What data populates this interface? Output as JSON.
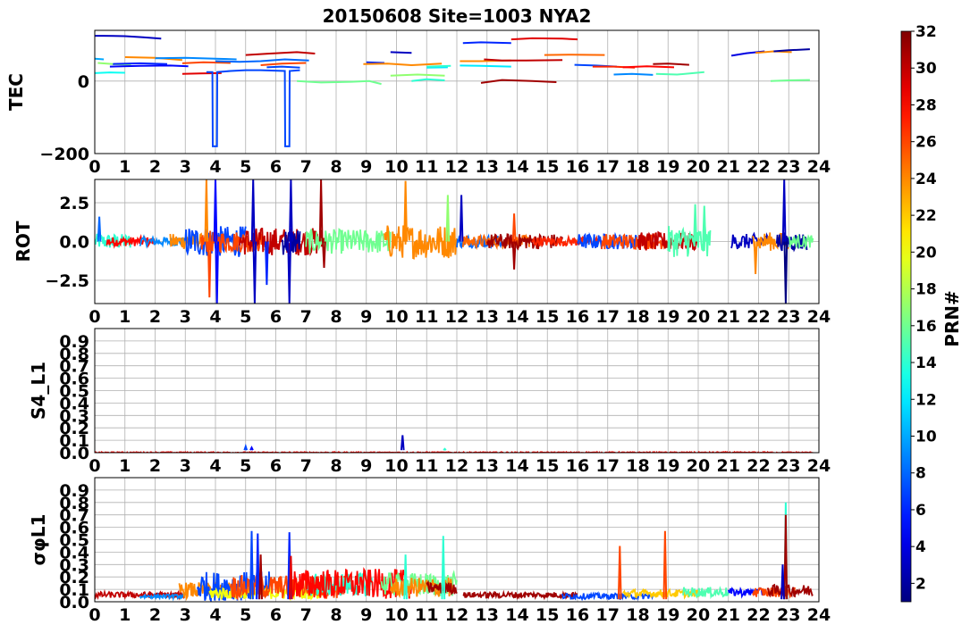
{
  "figure": {
    "title": "20150608 Site=1003 NYA2",
    "colorbar": {
      "label": "PRN#",
      "min": 1,
      "max": 32,
      "ticks": [
        2,
        4,
        6,
        8,
        10,
        12,
        14,
        16,
        18,
        20,
        22,
        24,
        26,
        28,
        30,
        32
      ],
      "colormap": "jet"
    }
  },
  "chart_data": [
    {
      "id": "tec",
      "type": "line",
      "ylabel": "TEC",
      "xlim": [
        0,
        24
      ],
      "ylim": [
        -200,
        140
      ],
      "xticks": [
        0,
        1,
        2,
        3,
        4,
        5,
        6,
        7,
        8,
        9,
        10,
        11,
        12,
        13,
        14,
        15,
        16,
        17,
        18,
        19,
        20,
        21,
        22,
        23,
        24
      ],
      "yticks": [
        0,
        -200
      ],
      "ytick_labels": [
        "0",
        "−200"
      ],
      "grid": true,
      "series": [
        {
          "prn": 3,
          "x": [
            0.0,
            0.3,
            1.0,
            1.6,
            2.2
          ],
          "y": [
            125,
            125,
            124,
            121,
            117
          ]
        },
        {
          "prn": 10,
          "x": [
            0.0,
            0.3
          ],
          "y": [
            62,
            60
          ]
        },
        {
          "prn": 13,
          "x": [
            0.0,
            0.5,
            1.0
          ],
          "y": [
            22,
            24,
            23
          ]
        },
        {
          "prn": 17,
          "x": [
            0.1,
            0.6,
            1.2
          ],
          "y": [
            50,
            47,
            45
          ]
        },
        {
          "prn": 5,
          "x": [
            0.5,
            1.5,
            2.5,
            3.1
          ],
          "y": [
            40,
            42,
            43,
            41
          ]
        },
        {
          "prn": 24,
          "x": [
            1.0,
            2.0,
            2.9
          ],
          "y": [
            66,
            64,
            58
          ]
        },
        {
          "prn": 6,
          "x": [
            0.6,
            1.5,
            2.4
          ],
          "y": [
            47,
            49,
            47
          ]
        },
        {
          "prn": 9,
          "x": [
            2.0,
            3.0,
            4.0,
            4.7
          ],
          "y": [
            63,
            64,
            62,
            60
          ]
        },
        {
          "prn": 26,
          "x": [
            2.9,
            3.6,
            4.5
          ],
          "y": [
            49,
            52,
            50
          ]
        },
        {
          "prn": 29,
          "x": [
            2.9,
            3.5,
            4.2
          ],
          "y": [
            20,
            21,
            22
          ]
        },
        {
          "prn": 7,
          "x": [
            3.7,
            3.9,
            3.91,
            4.05,
            4.06,
            4.5,
            5.0,
            5.5,
            6.3,
            6.31,
            6.45,
            6.46,
            6.8
          ],
          "y": [
            25,
            25,
            -180,
            -180,
            25,
            28,
            30,
            30,
            28,
            -180,
            -180,
            28,
            30
          ]
        },
        {
          "prn": 8,
          "x": [
            4.0,
            4.8,
            5.5,
            6.3,
            7.1
          ],
          "y": [
            55,
            53,
            55,
            60,
            57
          ]
        },
        {
          "prn": 30,
          "x": [
            5.0,
            5.8,
            6.7,
            7.3
          ],
          "y": [
            72,
            76,
            80,
            76
          ]
        },
        {
          "prn": 26,
          "x": [
            5.5,
            6.2,
            7.0
          ],
          "y": [
            44,
            48,
            50
          ]
        },
        {
          "prn": 7,
          "x": [
            5.7,
            6.2,
            6.8
          ],
          "y": [
            38,
            40,
            37
          ]
        },
        {
          "prn": 16,
          "x": [
            6.7,
            7.5,
            8.5,
            9.1,
            9.5
          ],
          "y": [
            0,
            -4,
            -2,
            0,
            -8
          ]
        },
        {
          "prn": 6,
          "x": [
            9.0,
            9.6
          ],
          "y": [
            52,
            50
          ]
        },
        {
          "prn": 24,
          "x": [
            8.9,
            9.7,
            10.5,
            11.5
          ],
          "y": [
            47,
            48,
            44,
            48
          ]
        },
        {
          "prn": 3,
          "x": [
            9.8,
            10.5
          ],
          "y": [
            80,
            78
          ]
        },
        {
          "prn": 14,
          "x": [
            10.5,
            11.0,
            11.6
          ],
          "y": [
            0,
            5,
            2
          ]
        },
        {
          "prn": 12,
          "x": [
            11.0,
            11.7
          ],
          "y": [
            37,
            38
          ]
        },
        {
          "prn": 17,
          "x": [
            9.8,
            10.7,
            11.6
          ],
          "y": [
            15,
            18,
            15
          ]
        },
        {
          "prn": 14,
          "x": [
            11.0,
            11.8
          ],
          "y": [
            40,
            42
          ]
        },
        {
          "prn": 6,
          "x": [
            12.2,
            12.8,
            13.8
          ],
          "y": [
            105,
            107,
            105
          ]
        },
        {
          "prn": 24,
          "x": [
            12.1,
            12.8,
            13.8
          ],
          "y": [
            55,
            55,
            57
          ]
        },
        {
          "prn": 12,
          "x": [
            12.1,
            12.8,
            13.8
          ],
          "y": [
            43,
            42,
            40
          ]
        },
        {
          "prn": 30,
          "x": [
            12.9,
            13.5,
            14.3,
            15.5
          ],
          "y": [
            60,
            57,
            57,
            58
          ]
        },
        {
          "prn": 29,
          "x": [
            13.8,
            14.5,
            15.5,
            16.0
          ],
          "y": [
            115,
            118,
            117,
            115
          ]
        },
        {
          "prn": 31,
          "x": [
            12.8,
            13.5,
            14.5,
            15.3
          ],
          "y": [
            -5,
            3,
            0,
            -3
          ]
        },
        {
          "prn": 25,
          "x": [
            14.9,
            15.8,
            16.9
          ],
          "y": [
            72,
            73,
            72
          ]
        },
        {
          "prn": 7,
          "x": [
            15.9,
            16.6,
            17.3
          ],
          "y": [
            45,
            43,
            40
          ]
        },
        {
          "prn": 27,
          "x": [
            16.5,
            17.2,
            17.9
          ],
          "y": [
            40,
            40,
            37
          ]
        },
        {
          "prn": 28,
          "x": [
            17.5,
            18.3,
            19.2
          ],
          "y": [
            38,
            41,
            38
          ]
        },
        {
          "prn": 31,
          "x": [
            18.5,
            19.0,
            19.7
          ],
          "y": [
            47,
            48,
            45
          ]
        },
        {
          "prn": 9,
          "x": [
            17.2,
            17.8,
            18.5
          ],
          "y": [
            18,
            20,
            17
          ]
        },
        {
          "prn": 15,
          "x": [
            18.6,
            19.3,
            20.2
          ],
          "y": [
            20,
            18,
            25
          ]
        },
        {
          "prn": 4,
          "x": [
            21.1,
            21.6,
            22.2
          ],
          "y": [
            70,
            77,
            82
          ]
        },
        {
          "prn": 24,
          "x": [
            21.9,
            22.5,
            23.1
          ],
          "y": [
            78,
            82,
            80
          ]
        },
        {
          "prn": 2,
          "x": [
            22.5,
            23.0,
            23.7
          ],
          "y": [
            82,
            85,
            88
          ]
        },
        {
          "prn": 16,
          "x": [
            22.4,
            23.0,
            23.7
          ],
          "y": [
            0,
            2,
            3
          ]
        }
      ]
    },
    {
      "id": "rot",
      "type": "line",
      "ylabel": "ROT",
      "xlim": [
        0,
        24
      ],
      "ylim": [
        -4,
        4
      ],
      "xticks": [
        0,
        1,
        2,
        3,
        4,
        5,
        6,
        7,
        8,
        9,
        10,
        11,
        12,
        13,
        14,
        15,
        16,
        17,
        18,
        19,
        20,
        21,
        22,
        23,
        24
      ],
      "yticks": [
        2.5,
        0.0,
        -2.5
      ],
      "ytick_labels": [
        "2.5",
        "0.0",
        "−2.5"
      ],
      "grid": true,
      "noise_segments": [
        {
          "prn": 14,
          "x0": 0.0,
          "x1": 1.2,
          "amp": 0.5
        },
        {
          "prn": 28,
          "x0": 0.4,
          "x1": 2.0,
          "amp": 0.3
        },
        {
          "prn": 9,
          "x0": 1.5,
          "x1": 3.0,
          "amp": 0.3
        },
        {
          "prn": 24,
          "x0": 2.5,
          "x1": 4.2,
          "amp": 0.5
        },
        {
          "prn": 7,
          "x0": 3.0,
          "x1": 5.0,
          "amp": 1.0
        },
        {
          "prn": 26,
          "x0": 3.5,
          "x1": 5.6,
          "amp": 0.7
        },
        {
          "prn": 30,
          "x0": 4.8,
          "x1": 7.6,
          "amp": 0.9
        },
        {
          "prn": 2,
          "x0": 6.2,
          "x1": 6.8,
          "amp": 0.9
        },
        {
          "prn": 16,
          "x0": 7.0,
          "x1": 9.8,
          "amp": 0.8
        },
        {
          "prn": 24,
          "x0": 9.6,
          "x1": 12.0,
          "amp": 1.1
        },
        {
          "prn": 8,
          "x0": 12.0,
          "x1": 13.5,
          "amp": 0.4
        },
        {
          "prn": 25,
          "x0": 12.2,
          "x1": 14.4,
          "amp": 0.4
        },
        {
          "prn": 31,
          "x0": 13.0,
          "x1": 15.5,
          "amp": 0.5
        },
        {
          "prn": 27,
          "x0": 14.5,
          "x1": 17.0,
          "amp": 0.3
        },
        {
          "prn": 7,
          "x0": 16.0,
          "x1": 18.0,
          "amp": 0.5
        },
        {
          "prn": 26,
          "x0": 16.8,
          "x1": 19.0,
          "amp": 0.5
        },
        {
          "prn": 30,
          "x0": 18.0,
          "x1": 20.0,
          "amp": 0.6
        },
        {
          "prn": 15,
          "x0": 19.0,
          "x1": 20.4,
          "amp": 1.0
        },
        {
          "prn": 3,
          "x0": 21.1,
          "x1": 22.3,
          "amp": 0.5
        },
        {
          "prn": 24,
          "x0": 21.8,
          "x1": 23.0,
          "amp": 0.6
        },
        {
          "prn": 2,
          "x0": 22.6,
          "x1": 23.6,
          "amp": 0.6
        },
        {
          "prn": 16,
          "x0": 23.0,
          "x1": 23.8,
          "amp": 0.4
        }
      ],
      "spikes": [
        {
          "prn": 8,
          "x": 0.15,
          "y": 1.6
        },
        {
          "prn": 24,
          "x": 3.7,
          "y": 4.0
        },
        {
          "prn": 26,
          "x": 3.8,
          "y": -3.6
        },
        {
          "prn": 5,
          "x": 4.0,
          "y": 4.0
        },
        {
          "prn": 5,
          "x": 4.05,
          "y": -4.0
        },
        {
          "prn": 3,
          "x": 5.25,
          "y": 4.0
        },
        {
          "prn": 3,
          "x": 5.3,
          "y": -4.0
        },
        {
          "prn": 6,
          "x": 5.7,
          "y": -2.8
        },
        {
          "prn": 3,
          "x": 6.5,
          "y": 4.0
        },
        {
          "prn": 3,
          "x": 6.45,
          "y": -4.0
        },
        {
          "prn": 31,
          "x": 7.5,
          "y": 4.0
        },
        {
          "prn": 31,
          "x": 7.6,
          "y": -1.7
        },
        {
          "prn": 24,
          "x": 10.3,
          "y": 3.9
        },
        {
          "prn": 17,
          "x": 11.7,
          "y": 3.0
        },
        {
          "prn": 3,
          "x": 12.15,
          "y": 3.0
        },
        {
          "prn": 31,
          "x": 13.9,
          "y": -1.8
        },
        {
          "prn": 26,
          "x": 13.9,
          "y": 1.8
        },
        {
          "prn": 15,
          "x": 20.2,
          "y": 2.3
        },
        {
          "prn": 15,
          "x": 19.9,
          "y": 2.4
        },
        {
          "prn": 24,
          "x": 21.9,
          "y": -2.1
        },
        {
          "prn": 3,
          "x": 22.85,
          "y": 4.0
        },
        {
          "prn": 1,
          "x": 22.9,
          "y": -4.0
        }
      ]
    },
    {
      "id": "s4",
      "type": "line",
      "ylabel": "S4_L1",
      "xlim": [
        0,
        24
      ],
      "ylim": [
        0,
        1.0
      ],
      "xticks": [
        0,
        1,
        2,
        3,
        4,
        5,
        6,
        7,
        8,
        9,
        10,
        11,
        12,
        13,
        14,
        15,
        16,
        17,
        18,
        19,
        20,
        21,
        22,
        23,
        24
      ],
      "yticks": [
        0.0,
        0.1,
        0.2,
        0.3,
        0.4,
        0.5,
        0.6,
        0.7,
        0.8,
        0.9
      ],
      "grid": true,
      "noise_segments": [
        {
          "prn": 28,
          "x0": 0.0,
          "x1": 23.8,
          "amp": 0.005
        }
      ],
      "spikes": [
        {
          "prn": 7,
          "x": 5.0,
          "y": 0.05
        },
        {
          "prn": 5,
          "x": 5.2,
          "y": 0.04
        },
        {
          "prn": 3,
          "x": 10.2,
          "y": 0.14
        },
        {
          "prn": 14,
          "x": 11.6,
          "y": 0.03
        }
      ]
    },
    {
      "id": "sigphi",
      "type": "line",
      "ylabel": "σφL1",
      "xlim": [
        0,
        24
      ],
      "ylim": [
        0,
        1.0
      ],
      "xticks": [
        0,
        1,
        2,
        3,
        4,
        5,
        6,
        7,
        8,
        9,
        10,
        11,
        12,
        13,
        14,
        15,
        16,
        17,
        18,
        19,
        20,
        21,
        22,
        23,
        24
      ],
      "yticks": [
        0.0,
        0.1,
        0.2,
        0.3,
        0.4,
        0.5,
        0.6,
        0.7,
        0.8,
        0.9
      ],
      "grid": true,
      "noise_segments": [
        {
          "prn": 30,
          "x0": 0.0,
          "x1": 3.0,
          "amp": 0.03,
          "base": 0.05
        },
        {
          "prn": 9,
          "x0": 1.5,
          "x1": 3.0,
          "amp": 0.02,
          "base": 0.04
        },
        {
          "prn": 24,
          "x0": 2.8,
          "x1": 5.0,
          "amp": 0.08,
          "base": 0.08
        },
        {
          "prn": 7,
          "x0": 3.4,
          "x1": 5.8,
          "amp": 0.15,
          "base": 0.1
        },
        {
          "prn": 20,
          "x0": 3.8,
          "x1": 7.5,
          "amp": 0.06,
          "base": 0.06
        },
        {
          "prn": 26,
          "x0": 4.5,
          "x1": 8.5,
          "amp": 0.12,
          "base": 0.1
        },
        {
          "prn": 14,
          "x0": 7.0,
          "x1": 9.2,
          "amp": 0.12,
          "base": 0.12
        },
        {
          "prn": 28,
          "x0": 6.5,
          "x1": 10.5,
          "amp": 0.15,
          "base": 0.12
        },
        {
          "prn": 16,
          "x0": 9.5,
          "x1": 12.0,
          "amp": 0.12,
          "base": 0.12
        },
        {
          "prn": 24,
          "x0": 9.8,
          "x1": 11.9,
          "amp": 0.1,
          "base": 0.1
        },
        {
          "prn": 31,
          "x0": 11.0,
          "x1": 12.0,
          "amp": 0.06,
          "base": 0.1
        },
        {
          "prn": 31,
          "x0": 12.2,
          "x1": 16.0,
          "amp": 0.03,
          "base": 0.05
        },
        {
          "prn": 7,
          "x0": 15.5,
          "x1": 18.5,
          "amp": 0.03,
          "base": 0.04
        },
        {
          "prn": 22,
          "x0": 17.5,
          "x1": 20.0,
          "amp": 0.04,
          "base": 0.06
        },
        {
          "prn": 15,
          "x0": 19.5,
          "x1": 21.0,
          "amp": 0.05,
          "base": 0.07
        },
        {
          "prn": 5,
          "x0": 21.0,
          "x1": 22.2,
          "amp": 0.04,
          "base": 0.07
        },
        {
          "prn": 26,
          "x0": 21.8,
          "x1": 23.2,
          "amp": 0.05,
          "base": 0.07
        },
        {
          "prn": 31,
          "x0": 22.3,
          "x1": 23.8,
          "amp": 0.06,
          "base": 0.08
        }
      ],
      "spikes": [
        {
          "prn": 7,
          "x": 5.2,
          "y": 0.57
        },
        {
          "prn": 6,
          "x": 5.4,
          "y": 0.55
        },
        {
          "prn": 31,
          "x": 5.5,
          "y": 0.38
        },
        {
          "prn": 6,
          "x": 6.45,
          "y": 0.56
        },
        {
          "prn": 29,
          "x": 6.5,
          "y": 0.37
        },
        {
          "prn": 14,
          "x": 10.3,
          "y": 0.38
        },
        {
          "prn": 14,
          "x": 11.55,
          "y": 0.53
        },
        {
          "prn": 26,
          "x": 17.4,
          "y": 0.45
        },
        {
          "prn": 26,
          "x": 18.9,
          "y": 0.57
        },
        {
          "prn": 14,
          "x": 22.9,
          "y": 0.8
        },
        {
          "prn": 31,
          "x": 22.9,
          "y": 0.7
        },
        {
          "prn": 3,
          "x": 22.8,
          "y": 0.3
        }
      ]
    }
  ]
}
